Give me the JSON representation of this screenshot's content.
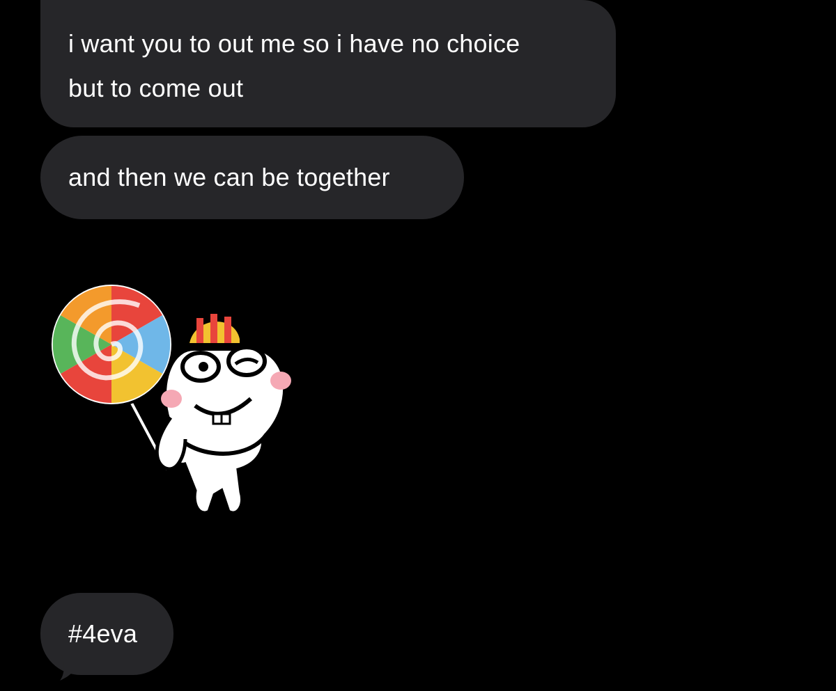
{
  "conversation": {
    "messages": [
      {
        "text_line_1": "i want you to out me so i have no choice",
        "text_line_2": "but to come out"
      },
      {
        "text": "and then we can be together"
      },
      {
        "sticker": "lollipop-bunny-sticker"
      },
      {
        "text": "#4eva"
      }
    ]
  },
  "colors": {
    "background": "#000000",
    "bubble": "#262629",
    "text": "#ffffff"
  }
}
